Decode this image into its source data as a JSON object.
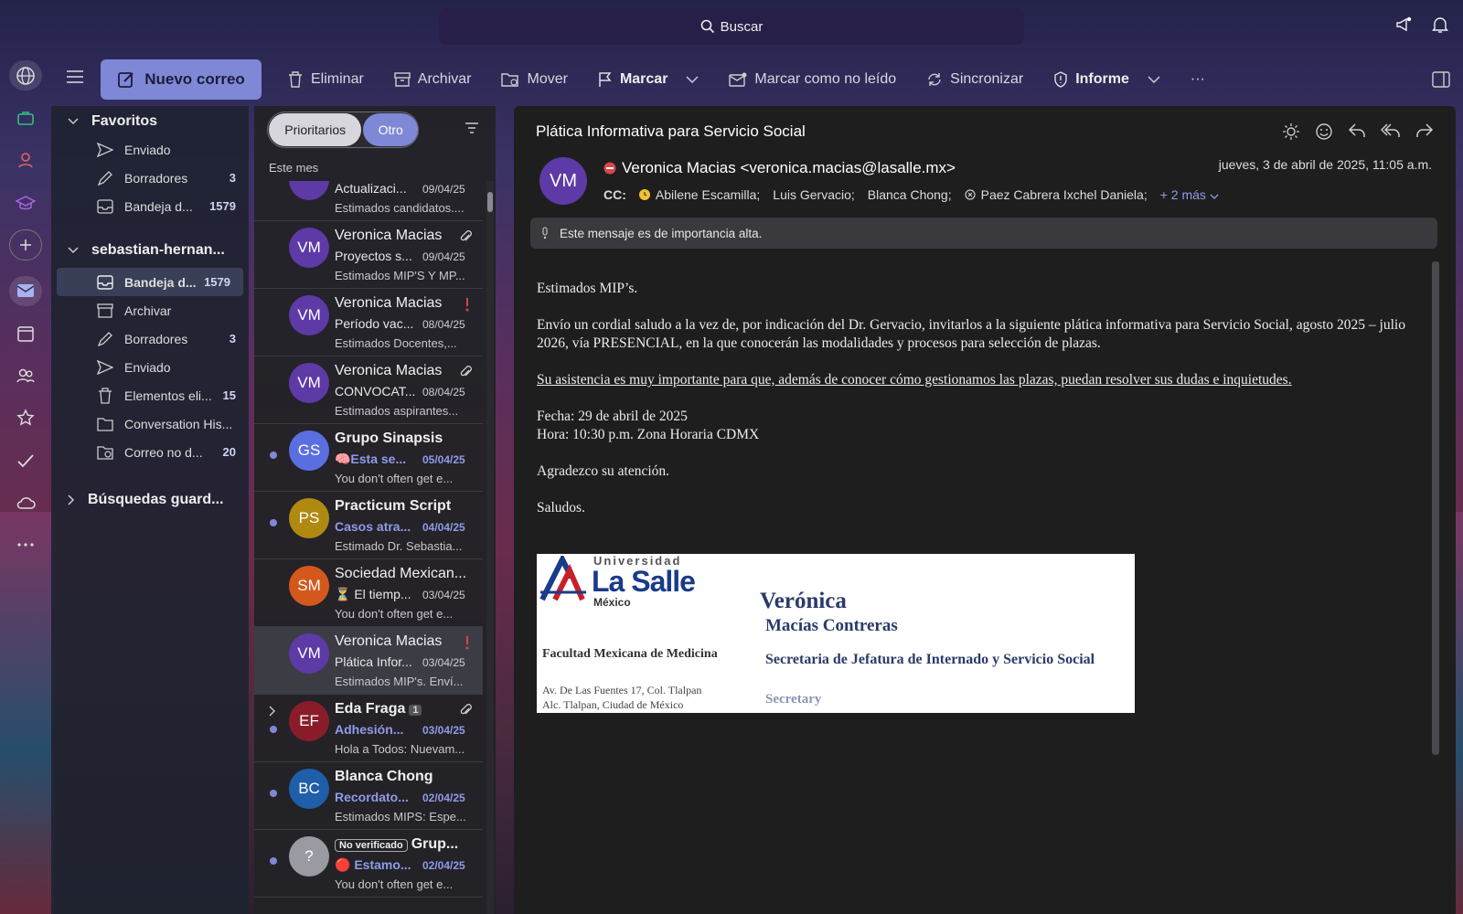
{
  "search": {
    "label": "Buscar"
  },
  "toolbar": {
    "new_mail": "Nuevo correo",
    "delete": "Eliminar",
    "archive": "Archivar",
    "move": "Mover",
    "flag": "Marcar",
    "mark_unread": "Marcar como no leído",
    "sync": "Sincronizar",
    "report": "Informe",
    "more": "···"
  },
  "favorites": {
    "title": "Favoritos",
    "items": [
      {
        "label": "Enviado",
        "count": ""
      },
      {
        "label": "Borradores",
        "count": "3"
      },
      {
        "label": "Bandeja d...",
        "count": "1579"
      }
    ]
  },
  "account": {
    "title": "sebastian-hernan...",
    "items": [
      {
        "label": "Bandeja d...",
        "count": "1579"
      },
      {
        "label": "Archivar",
        "count": ""
      },
      {
        "label": "Borradores",
        "count": "3"
      },
      {
        "label": "Enviado",
        "count": ""
      },
      {
        "label": "Elementos eli...",
        "count": "15"
      },
      {
        "label": "Conversation His...",
        "count": ""
      },
      {
        "label": "Correo no d...",
        "count": "20"
      }
    ]
  },
  "saved_searches": "Búsquedas guard...",
  "list": {
    "tab_focused": "Prioritarios",
    "tab_other": "Otro",
    "group_label": "Este mes",
    "messages": [
      {
        "sender": "",
        "subject": "Actualizaci...",
        "date": "09/04/25",
        "preview": "Estimados candidatos...."
      },
      {
        "initials": "VM",
        "sender": "Veronica Macias",
        "subject": "Proyectos s...",
        "date": "09/04/25",
        "preview": "Estimados MIP'S Y MP..."
      },
      {
        "initials": "VM",
        "sender": "Veronica Macias",
        "subject": "Período vac...",
        "date": "08/04/25",
        "preview": "Estimados Docentes,..."
      },
      {
        "initials": "VM",
        "sender": "Veronica Macias",
        "subject": "CONVOCAT...",
        "date": "08/04/25",
        "preview": "Estimados aspirantes..."
      },
      {
        "initials": "GS",
        "sender": "Grupo Sinapsis",
        "subject": "🧠Esta se...",
        "date": "05/04/25",
        "preview": "You don't often get e..."
      },
      {
        "initials": "PS",
        "sender": "Practicum Script",
        "subject": "Casos atra...",
        "date": "04/04/25",
        "preview": "Estimado Dr. Sebastia..."
      },
      {
        "initials": "SM",
        "sender": "Sociedad Mexican...",
        "subject": "⏳ El tiemp...",
        "date": "03/04/25",
        "preview": "You don't often get e..."
      },
      {
        "initials": "VM",
        "sender": "Veronica Macias",
        "subject": "Plática Infor...",
        "date": "03/04/25",
        "preview": "Estimados MIP's. Enví..."
      },
      {
        "initials": "EF",
        "sender": "Eda Fraga",
        "count": "1",
        "subject": "Adhesión...",
        "date": "03/04/25",
        "preview": "Hola a Todos: Nuevam..."
      },
      {
        "initials": "BC",
        "sender": "Blanca Chong",
        "subject": "Recordato...",
        "date": "02/04/25",
        "preview": "Estimados MIPS: Espe..."
      },
      {
        "initials": "?",
        "badge": "No verificado",
        "sender": "Grup...",
        "subject": "🔴 Estamo...",
        "date": "02/04/25",
        "preview": "You don't often get e..."
      }
    ]
  },
  "reading": {
    "subject": "Plática Informativa para Servicio Social",
    "avatar": "VM",
    "from": "Veronica Macias <veronica.macias@lasalle.mx>",
    "date": "jueves, 3 de abril de 2025, 11:05 a.m.",
    "cc_label": "CC:",
    "cc": [
      "Abilene Escamilla;",
      "Luis Gervacio;",
      "Blanca Chong;",
      "Paez Cabrera Ixchel Daniela;"
    ],
    "cc_more": "+ 2 más",
    "importance": "Este mensaje es de importancia alta.",
    "body": {
      "p1": "Estimados MIP’s.",
      "p2": "Envío un cordial saludo a la vez de, por indicación del Dr. Gervacio, invitarlos a la siguiente plática informativa para Servicio Social, agosto 2025 – julio 2026, vía PRESENCIAL, en la que conocerán las modalidades y procesos para selección de plazas.",
      "p3": "Su asistencia es muy importante para que, además de conocer cómo gestionamos las plazas, puedan resolver sus dudas e inquietudes.",
      "fecha": "Fecha: 29 de abril de 2025",
      "hora": "Hora: 10:30 p.m. Zona Horaria CDMX",
      "p4": "Agradezco su atención.",
      "p5": "Saludos."
    },
    "signature": {
      "univ_small": "Universidad",
      "univ_big": "La Salle",
      "country": "México",
      "faculty": "Facultad Mexicana de Medicina",
      "addr1": "Av. De Las Fuentes 17, Col. Tlalpan",
      "addr2": "Alc. Tlalpan, Ciudad de México",
      "name1": "Verónica",
      "name2": "Macías Contreras",
      "role": "Secretaria de Jefatura de Internado y Servicio Social",
      "title": "Secretary"
    }
  },
  "colors": {
    "accent": "#7e88d6",
    "unread_blue": "#8f9be8",
    "importance_red": "#d9464a"
  }
}
